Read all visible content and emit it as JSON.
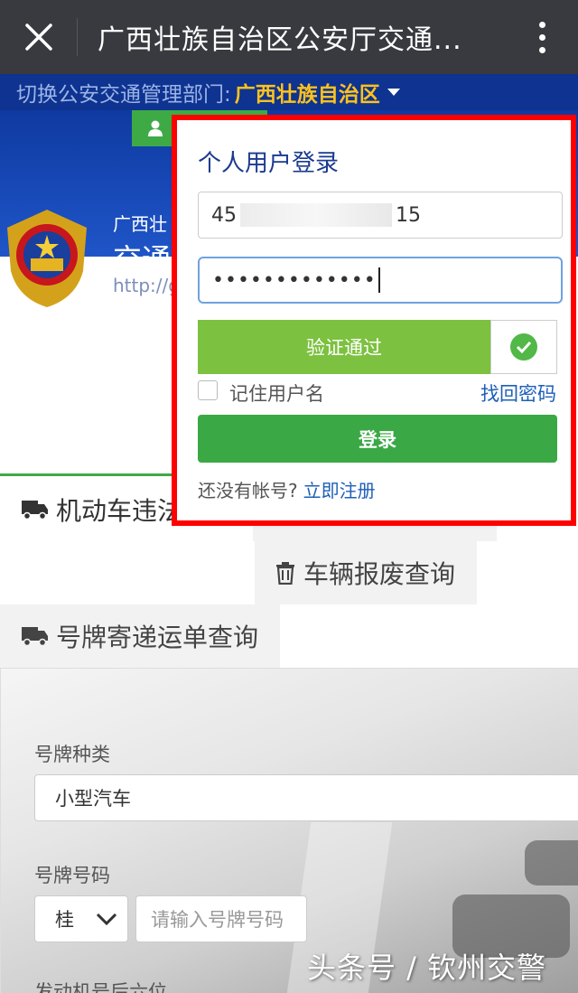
{
  "topbar": {
    "close_icon": "close-icon",
    "title": "广西壮族自治区公安厅交通...",
    "more_icon": "more-vertical-icon"
  },
  "dept": {
    "label": "切换公安交通管理部门:",
    "current": "广西壮族自治区"
  },
  "banner": {
    "site_small": "广西壮",
    "site_big": "交通",
    "url": "http://g"
  },
  "tabs": {
    "vehicle": "机动车违法",
    "scrap": "车辆报废查询",
    "plate_mail": "号牌寄递运单查询"
  },
  "form": {
    "plate_type_label": "号牌种类",
    "plate_type_value": "小型汽车",
    "plate_number_label": "号牌号码",
    "province": "桂",
    "plate_placeholder": "请输入号牌号码",
    "engine_label": "发动机号后六位"
  },
  "login": {
    "title": "个人用户登录",
    "username_start": "45",
    "username_end": "15",
    "password_masked": "•••••••••••••",
    "verify_text": "验证通过",
    "remember": "记住用户名",
    "forgot": "找回密码",
    "login_button": "登录",
    "no_account": "还没有帐号?",
    "register": "立即注册"
  },
  "watermark": "头条号 / 钦州交警",
  "colors": {
    "green": "#3aa845",
    "blue_banner": "#0e3390",
    "highlight_red": "#ff0000"
  }
}
